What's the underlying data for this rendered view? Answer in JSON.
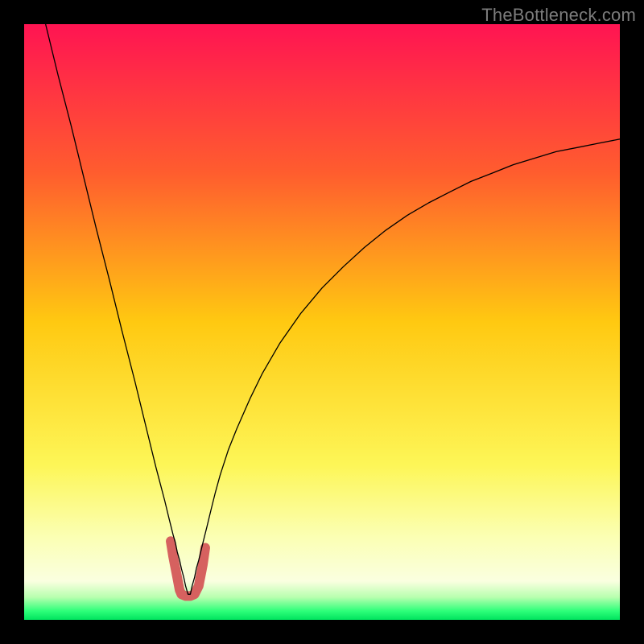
{
  "watermark": "TheBottleneck.com",
  "chart_data": {
    "type": "line",
    "title": "",
    "xlabel": "",
    "ylabel": "",
    "xlim": [
      0,
      100
    ],
    "ylim": [
      0,
      100
    ],
    "grid": false,
    "legend": false,
    "background_gradient": {
      "stops": [
        {
          "offset": 0.0,
          "color": "#ff1452"
        },
        {
          "offset": 0.25,
          "color": "#ff5d2e"
        },
        {
          "offset": 0.5,
          "color": "#ffc911"
        },
        {
          "offset": 0.74,
          "color": "#fdf657"
        },
        {
          "offset": 0.86,
          "color": "#fbffb3"
        },
        {
          "offset": 0.935,
          "color": "#faffe0"
        },
        {
          "offset": 0.962,
          "color": "#b8ffaf"
        },
        {
          "offset": 0.985,
          "color": "#2eff7a"
        },
        {
          "offset": 1.0,
          "color": "#00e35e"
        }
      ]
    },
    "series": [
      {
        "name": "bottleneck-curve",
        "stroke": "#000000",
        "stroke_width": 1.3,
        "x": [
          3.6,
          5.7,
          7.9,
          10.0,
          12.1,
          14.3,
          16.4,
          18.6,
          20.7,
          22.1,
          23.6,
          24.3,
          25.0,
          25.4,
          25.7,
          26.1,
          26.4,
          26.8,
          27.1,
          27.5,
          27.9,
          28.2,
          28.6,
          28.9,
          29.3,
          29.3,
          30.0,
          30.7,
          31.4,
          32.1,
          32.9,
          34.3,
          35.7,
          37.9,
          40.0,
          42.9,
          46.4,
          50.0,
          53.6,
          57.1,
          60.7,
          64.3,
          67.9,
          71.4,
          75.0,
          78.6,
          82.1,
          85.7,
          89.3,
          92.9,
          96.4,
          100.0
        ],
        "y": [
          100.0,
          91.4,
          82.9,
          74.3,
          65.7,
          57.1,
          48.6,
          40.0,
          31.4,
          25.7,
          20.0,
          17.1,
          14.3,
          12.9,
          11.4,
          10.0,
          8.6,
          7.1,
          5.7,
          4.3,
          4.3,
          5.7,
          7.1,
          8.6,
          10.0,
          10.0,
          12.9,
          15.7,
          18.6,
          21.4,
          24.3,
          28.6,
          32.1,
          37.1,
          41.4,
          46.4,
          51.4,
          55.7,
          59.3,
          62.5,
          65.4,
          67.9,
          70.0,
          71.8,
          73.6,
          75.0,
          76.4,
          77.5,
          78.6,
          79.3,
          80.0,
          80.7
        ]
      },
      {
        "name": "trough-highlight",
        "stroke": "#d6615f",
        "stroke_width": 12,
        "linecap": "round",
        "x": [
          24.6,
          25.0,
          25.7,
          26.1,
          26.4,
          27.1,
          27.9,
          28.6,
          29.3,
          30.0,
          30.4
        ],
        "y": [
          13.2,
          10.7,
          7.1,
          5.0,
          4.3,
          4.0,
          4.0,
          4.3,
          5.7,
          9.3,
          12.1
        ]
      }
    ]
  }
}
